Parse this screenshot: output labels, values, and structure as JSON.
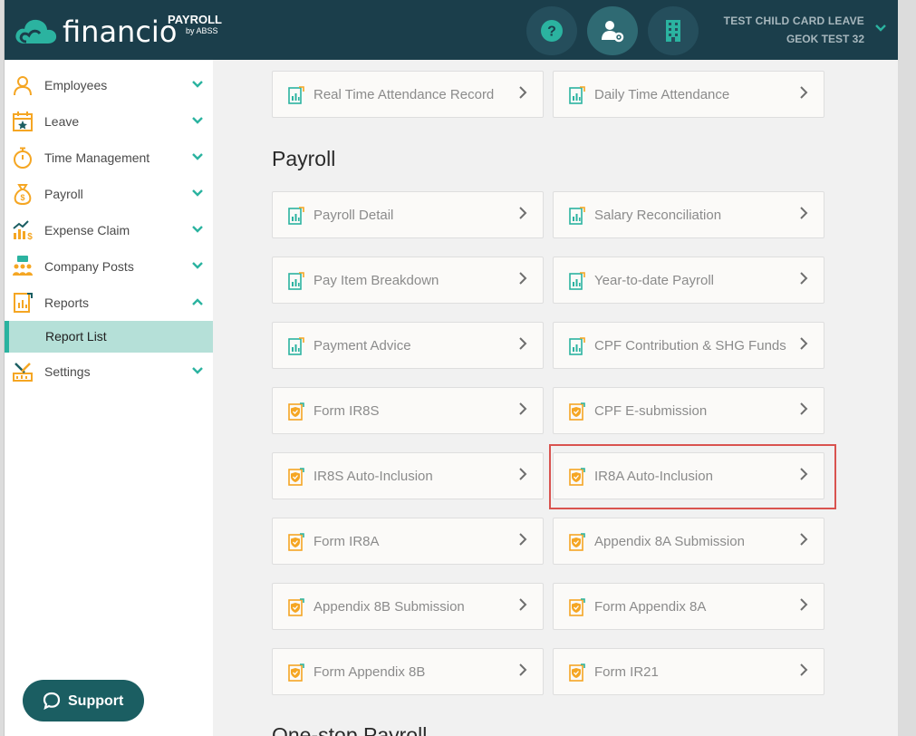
{
  "app": {
    "logo_text": "financio",
    "logo_product": "PAYROLL",
    "logo_byline": "by ABSS"
  },
  "header": {
    "company_name": "TEST CHILD CARD LEAVE",
    "account_name": "GEOK TEST 32"
  },
  "sidebar": {
    "items": [
      {
        "label": "Employees",
        "icon": "person-icon",
        "expanded": false
      },
      {
        "label": "Leave",
        "icon": "calendar-star-icon",
        "expanded": false
      },
      {
        "label": "Time Management",
        "icon": "stopwatch-icon",
        "expanded": false
      },
      {
        "label": "Payroll",
        "icon": "money-bag-icon",
        "expanded": false
      },
      {
        "label": "Expense Claim",
        "icon": "expense-chart-icon",
        "expanded": false
      },
      {
        "label": "Company Posts",
        "icon": "people-chat-icon",
        "expanded": false
      },
      {
        "label": "Reports",
        "icon": "report-icon",
        "expanded": true
      },
      {
        "label": "Settings",
        "icon": "settings-tools-icon",
        "expanded": false
      }
    ],
    "sub_item": "Report List",
    "support_label": "Support"
  },
  "main": {
    "top_cards": [
      {
        "label": "Real Time Attendance Record",
        "icon": "report-chart-icon"
      },
      {
        "label": "Daily Time Attendance",
        "icon": "report-chart-icon"
      }
    ],
    "payroll_section": {
      "title": "Payroll",
      "cards": [
        {
          "label": "Payroll Detail",
          "icon": "report-chart-icon"
        },
        {
          "label": "Salary Reconciliation",
          "icon": "report-chart-icon"
        },
        {
          "label": "Pay Item Breakdown",
          "icon": "report-chart-icon"
        },
        {
          "label": "Year-to-date Payroll",
          "icon": "report-chart-icon"
        },
        {
          "label": "Payment Advice",
          "icon": "report-chart-icon"
        },
        {
          "label": "CPF Contribution & SHG Funds",
          "icon": "report-chart-icon"
        },
        {
          "label": "Form IR8S",
          "icon": "form-shield-icon"
        },
        {
          "label": "CPF E-submission",
          "icon": "form-shield-icon"
        },
        {
          "label": "IR8S Auto-Inclusion",
          "icon": "form-shield-icon"
        },
        {
          "label": "IR8A Auto-Inclusion",
          "icon": "form-shield-icon"
        },
        {
          "label": "Form IR8A",
          "icon": "form-shield-icon"
        },
        {
          "label": "Appendix 8A Submission",
          "icon": "form-shield-icon"
        },
        {
          "label": "Appendix 8B Submission",
          "icon": "form-shield-icon"
        },
        {
          "label": "Form Appendix 8A",
          "icon": "form-shield-icon"
        },
        {
          "label": "Form Appendix 8B",
          "icon": "form-shield-icon"
        },
        {
          "label": "Form IR21",
          "icon": "form-shield-icon"
        }
      ]
    },
    "next_section_title": "One-stop Payroll"
  },
  "colors": {
    "header_bg": "#1b3e4b",
    "accent_teal": "#2bb3a0",
    "icon_orange": "#f5a623",
    "highlight_red": "#d9534f"
  }
}
